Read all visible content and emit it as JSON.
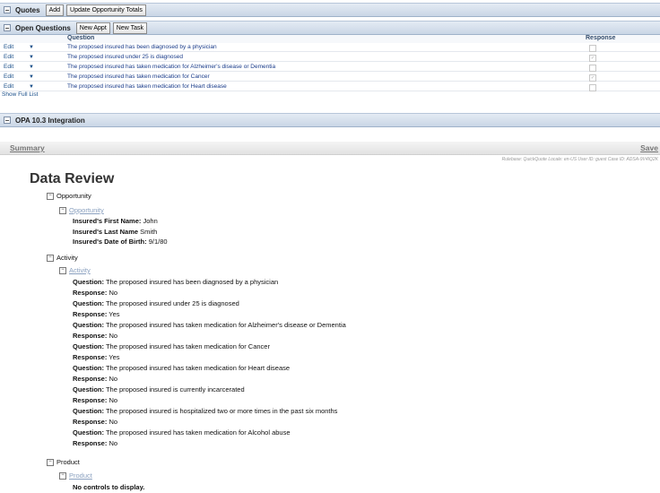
{
  "quotes": {
    "title": "Quotes",
    "add": "Add",
    "update": "Update Opportunity Totals"
  },
  "open_questions": {
    "title": "Open Questions",
    "new_appt": "New Appt",
    "new_task": "New Task",
    "col_question": "Question",
    "col_response": "Response",
    "rows": [
      {
        "edit": "Edit",
        "question": "The proposed insured has been diagnosed by a physician",
        "checked": false
      },
      {
        "edit": "Edit",
        "question": "The proposed insured under 25 is diagnosed",
        "checked": true
      },
      {
        "edit": "Edit",
        "question": "The proposed insured has taken medication for Alzheimer's disease or Dementia",
        "checked": false
      },
      {
        "edit": "Edit",
        "question": "The proposed insured has taken medication for Cancer",
        "checked": true
      },
      {
        "edit": "Edit",
        "question": "The proposed insured has taken medication for Heart disease",
        "checked": false
      }
    ],
    "show_full_list": "Show Full List"
  },
  "opa": {
    "title": "OPA 10.3 Integration"
  },
  "tabs": {
    "summary": "Summary",
    "save": "Save"
  },
  "rulebase_line": "Rulebase: QuickQuote Locale: en-US User ID: guest Case ID: ADSA-9V4IQ2K",
  "data_review": {
    "title": "Data Review",
    "opportunity": {
      "label": "Opportunity",
      "sub": "Opportunity",
      "fields": [
        {
          "label": "Insured's First Name:",
          "value": "John"
        },
        {
          "label": "Insured's Last Name",
          "value": "Smith"
        },
        {
          "label": "Insured's Date of Birth:",
          "value": "9/1/80"
        }
      ]
    },
    "activity": {
      "label": "Activity",
      "sub": "Activity",
      "q_label": "Question:",
      "r_label": "Response:",
      "items": [
        {
          "q": "The proposed insured has been diagnosed by a physician",
          "r": "No"
        },
        {
          "q": "The proposed insured under 25 is diagnosed",
          "r": "Yes"
        },
        {
          "q": "The proposed insured has taken medication for Alzheimer's disease or Dementia",
          "r": "No"
        },
        {
          "q": "The proposed insured has taken medication for Cancer",
          "r": "Yes"
        },
        {
          "q": "The proposed insured has taken medication for Heart disease",
          "r": "No"
        },
        {
          "q": "The proposed insured is currently incarcerated",
          "r": "No"
        },
        {
          "q": "The proposed insured is hospitalized two or more times in the past six months",
          "r": "No"
        },
        {
          "q": "The proposed insured has taken medication for Alcohol abuse",
          "r": "No"
        }
      ]
    },
    "product": {
      "label": "Product",
      "sub": "Product",
      "empty": "No controls to display."
    }
  }
}
